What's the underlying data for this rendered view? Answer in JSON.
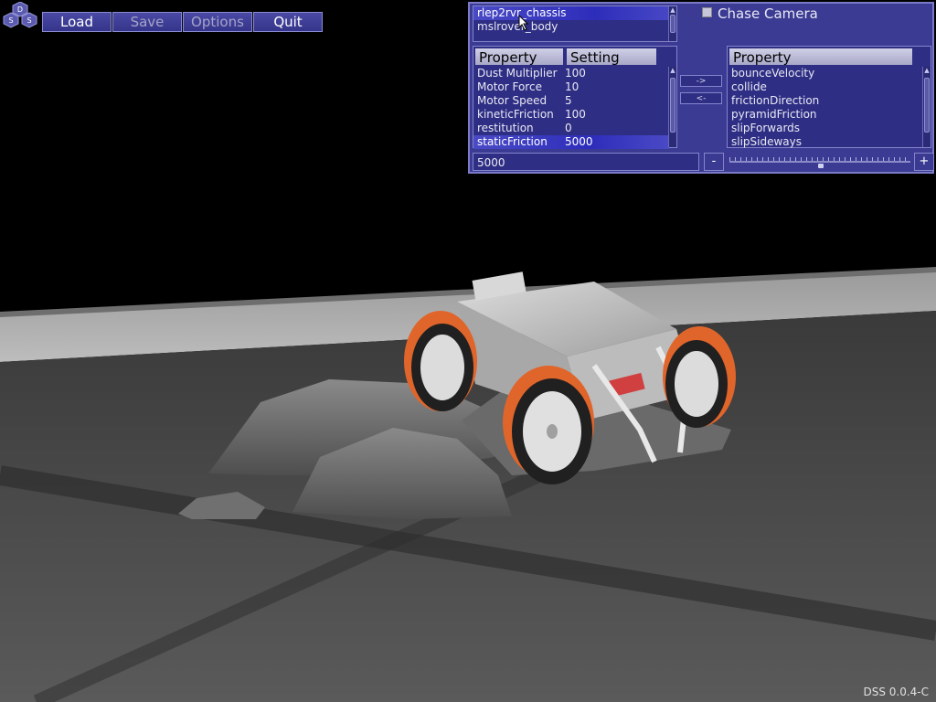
{
  "logo": {
    "letters": [
      "D",
      "S",
      "S"
    ]
  },
  "toolbar": {
    "buttons": [
      {
        "label": "Load",
        "enabled": true
      },
      {
        "label": "Save",
        "enabled": false
      },
      {
        "label": "Options",
        "enabled": false
      },
      {
        "label": "Quit",
        "enabled": true
      }
    ]
  },
  "panel": {
    "objects": [
      "rlep2rvr_chassis",
      "mslrover_body"
    ],
    "selected_object": "rlep2rvr_chassis",
    "chase_camera_label": "Chase Camera",
    "chase_camera_checked": false,
    "left_table": {
      "headers": [
        "Property",
        "Setting"
      ],
      "rows": [
        {
          "property": "Dust Multiplier",
          "setting": "100"
        },
        {
          "property": "Motor Force",
          "setting": "10"
        },
        {
          "property": "Motor Speed",
          "setting": "5"
        },
        {
          "property": "kineticFriction",
          "setting": "100"
        },
        {
          "property": "restitution",
          "setting": "0"
        },
        {
          "property": "staticFriction",
          "setting": "5000"
        }
      ],
      "selected_row": "staticFriction"
    },
    "move_right_label": "->",
    "move_left_label": "<-",
    "right_table": {
      "header": "Property",
      "rows": [
        "bounceVelocity",
        "collide",
        "frictionDirection",
        "pyramidFriction",
        "slipForwards",
        "slipSideways"
      ]
    },
    "value_field": "5000",
    "minus_label": "-",
    "plus_label": "+",
    "slider_value": 0.5
  },
  "version": "DSS 0.0.4-C",
  "colors": {
    "panel_bg": "#3b3b94",
    "selection": "#2d2dbb",
    "fender": "#e0652a",
    "ground": "#4a4a4a"
  }
}
